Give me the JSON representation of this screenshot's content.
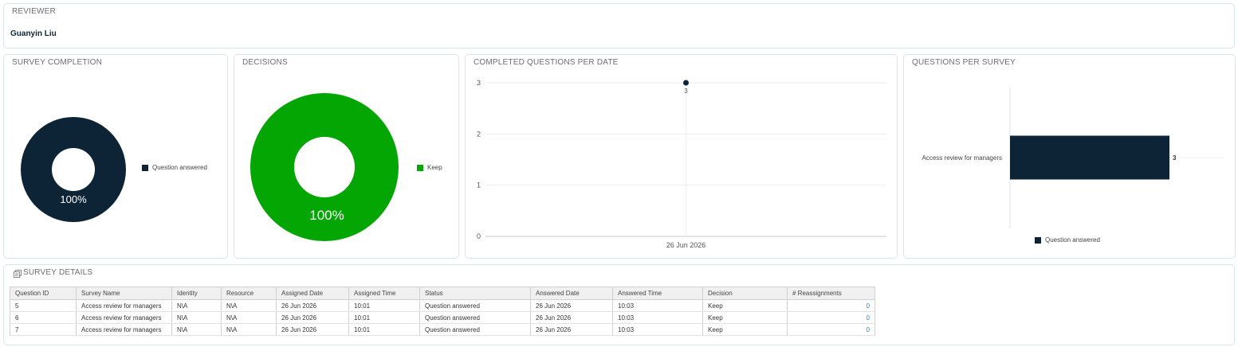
{
  "reviewer": {
    "title": "REVIEWER",
    "name": "Guanyin Liu"
  },
  "survey_completion": {
    "title": "SURVEY COMPLETION",
    "percent_label": "100%",
    "legend": "Question answered",
    "color": "#0d2436"
  },
  "decisions": {
    "title": "DECISIONS",
    "percent_label": "100%",
    "legend": "Keep",
    "color": "#04a604"
  },
  "completed_per_date": {
    "title": "COMPLETED QUESTIONS PER DATE"
  },
  "questions_per_survey": {
    "title": "QUESTIONS PER SURVEY",
    "legend": "Question answered"
  },
  "survey_details": {
    "title": "SURVEY DETAILS",
    "columns": [
      "Question ID",
      "Survey Name",
      "Identity",
      "Resource",
      "Assigned Date",
      "Assigned Time",
      "Status",
      "Answered Date",
      "Answered Time",
      "Decision",
      "# Reassignments"
    ],
    "rows": [
      [
        "5",
        "Access review for managers",
        "N\\A",
        "N\\A",
        "26 Jun 2026",
        "10:01",
        "Question answered",
        "26 Jun 2026",
        "10:03",
        "Keep",
        "0"
      ],
      [
        "6",
        "Access review for managers",
        "N\\A",
        "N\\A",
        "26 Jun 2026",
        "10:01",
        "Question answered",
        "26 Jun 2026",
        "10:03",
        "Keep",
        "0"
      ],
      [
        "7",
        "Access review for managers",
        "N\\A",
        "N\\A",
        "26 Jun 2026",
        "10:01",
        "Question answered",
        "26 Jun 2026",
        "10:03",
        "Keep",
        "0"
      ]
    ]
  },
  "chart_data": [
    {
      "type": "pie",
      "donut": true,
      "title": "SURVEY COMPLETION",
      "categories": [
        "Question answered"
      ],
      "values": [
        100
      ],
      "data_labels": [
        "100%"
      ],
      "colors": [
        "#0d2436"
      ],
      "legend": "right"
    },
    {
      "type": "pie",
      "donut": true,
      "title": "DECISIONS",
      "categories": [
        "Keep"
      ],
      "values": [
        100
      ],
      "data_labels": [
        "100%"
      ],
      "colors": [
        "#04a604"
      ],
      "legend": "right"
    },
    {
      "type": "scatter",
      "title": "COMPLETED QUESTIONS PER DATE",
      "x": [
        "26 Jun 2026"
      ],
      "y": [
        3
      ],
      "data_labels": [
        "3"
      ],
      "ylim": [
        0,
        3
      ],
      "yticks": [
        "0",
        "1",
        "2",
        "3"
      ],
      "grid": true,
      "colors": [
        "#0d2436"
      ]
    },
    {
      "type": "bar",
      "orientation": "horizontal",
      "title": "QUESTIONS PER SURVEY",
      "categories": [
        "Access review for managers"
      ],
      "series": [
        {
          "name": "Question answered",
          "values": [
            3
          ]
        }
      ],
      "data_labels": [
        "3"
      ],
      "colors": [
        "#0d2436"
      ],
      "legend": "bottom"
    }
  ]
}
